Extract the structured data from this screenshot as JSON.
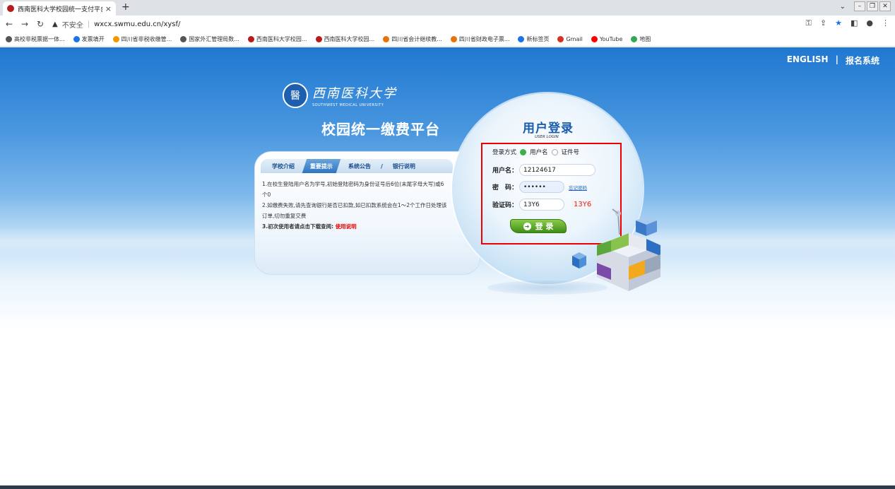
{
  "browser": {
    "tab_title": "西南医科大学校园统一支付平台",
    "tab_close": "×",
    "new_tab": "+",
    "url_warning": "不安全",
    "url": "wxcx.swmu.edu.cn/xysf/",
    "bookmarks": [
      {
        "label": "高校非税票据一体...",
        "color": "#555"
      },
      {
        "label": "发票填开",
        "color": "#1a73e8"
      },
      {
        "label": "四川省非税收缴管...",
        "color": "#f29900"
      },
      {
        "label": "国家外汇管理局数...",
        "color": "#555"
      },
      {
        "label": "西南医科大学校园...",
        "color": "#b71c1c"
      },
      {
        "label": "西南医科大学校园...",
        "color": "#b71c1c"
      },
      {
        "label": "四川省会计继续教...",
        "color": "#e8710a"
      },
      {
        "label": "四川省财政电子票...",
        "color": "#e8710a"
      },
      {
        "label": "新标签页",
        "color": "#1a73e8"
      },
      {
        "label": "Gmail",
        "color": "#d93025"
      },
      {
        "label": "YouTube",
        "color": "#ff0000"
      },
      {
        "label": "地图",
        "color": "#34a853"
      }
    ]
  },
  "header": {
    "english_link": "ENGLISH",
    "divider": "|",
    "register_link": "报名系统"
  },
  "logo": {
    "seal_char": "醫",
    "name_cn": "西南医科大学",
    "name_en": "SOUTHWEST MEDICAL UNIVERSITY"
  },
  "platform_title": "校园统一缴费平台",
  "info_panel": {
    "tabs": [
      {
        "label": "学校介绍",
        "active": false
      },
      {
        "label": "重要提示",
        "active": true
      },
      {
        "label": "系统公告",
        "active": false
      },
      {
        "label": "银行说明",
        "active": false
      }
    ],
    "tab_separator": "/",
    "notice_1": "1.在校生登陆用户名为学号,初始登陆密码为身份证号后6位(末尾字母大写)或6个0",
    "notice_2": "2.如缴费失败,请先查询银行是否已扣款,如已扣款系统会在1～2个工作日处理该订单,切勿重复交费",
    "notice_3_prefix": "3.初次使用者请点击下载查阅: ",
    "notice_3_link": "使用说明"
  },
  "login": {
    "title": "用户登录",
    "subtitle": "USER LOGIN",
    "mode_label": "登录方式",
    "mode_options": [
      {
        "label": "用户名",
        "selected": true
      },
      {
        "label": "证件号",
        "selected": false
      }
    ],
    "username_label": "用户名：",
    "username_value": "12124617",
    "password_label": "密　码：",
    "password_value": "••••••",
    "forgot_link": "忘记密码",
    "captcha_label": "验证码：",
    "captcha_value": "13Y6",
    "captcha_image_text": "13Y6",
    "submit_label": "登 录"
  },
  "colors": {
    "hero_blue": "#1f78d1",
    "title_blue": "#1b5dab",
    "highlight_red": "#e00000",
    "button_green": "#3f8e17"
  }
}
